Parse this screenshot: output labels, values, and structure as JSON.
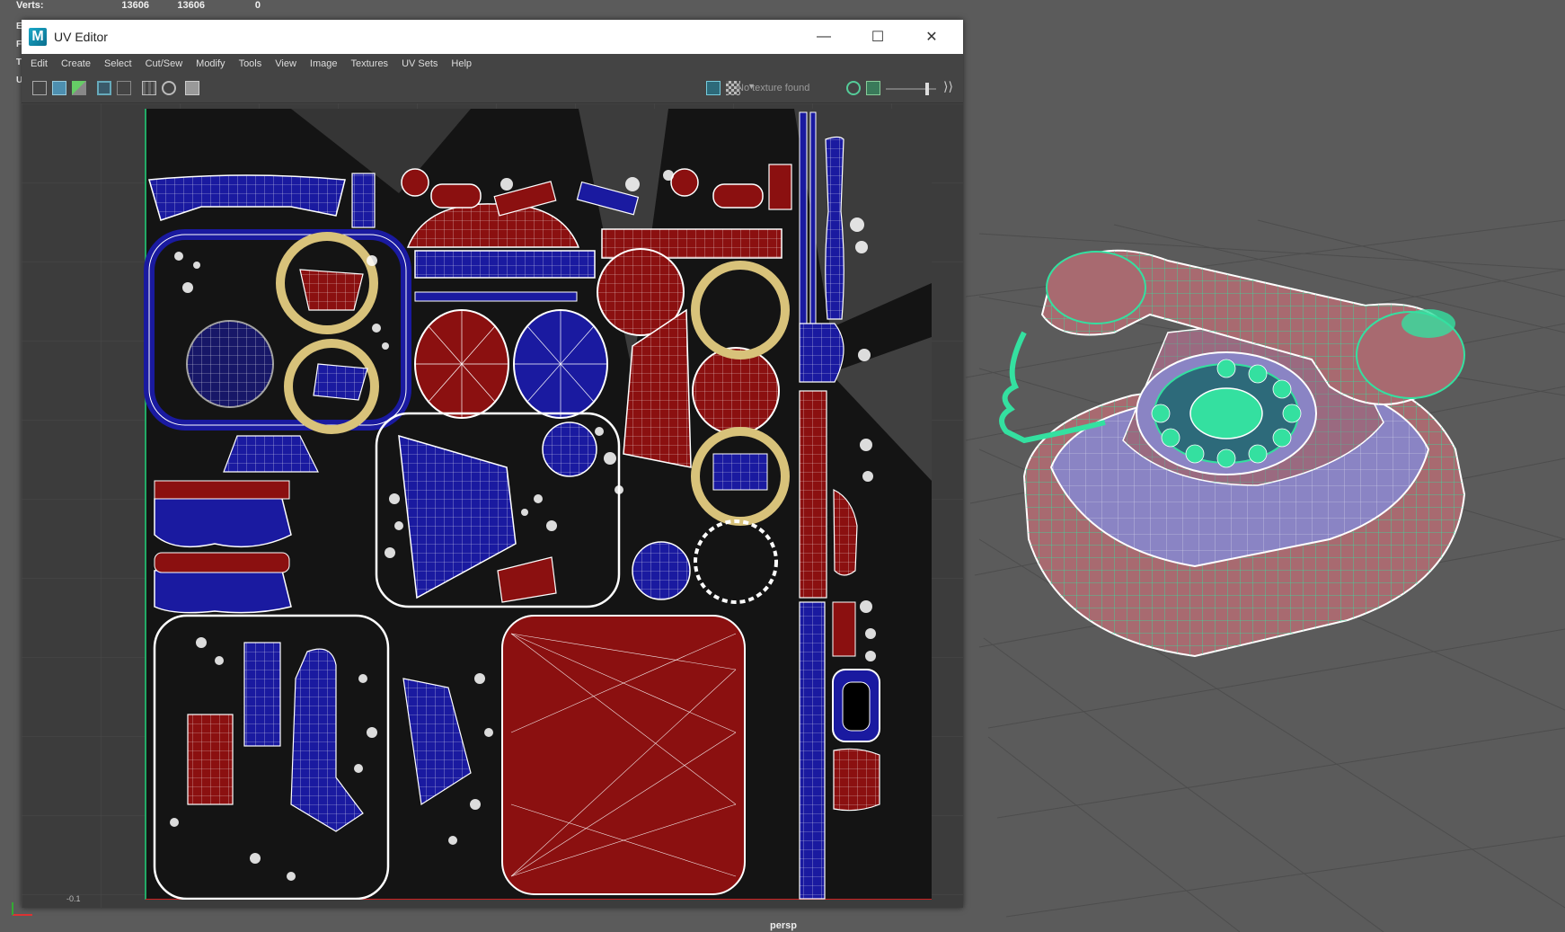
{
  "hud": {
    "verts_label": "Verts:",
    "verts_a": "13606",
    "verts_b": "13606",
    "verts_c": "0",
    "side_letters": [
      "E",
      "F",
      "T",
      "U"
    ]
  },
  "window": {
    "title": "UV Editor",
    "app_icon_letter": "M",
    "minimize": "—",
    "maximize": "☐",
    "close": "✕"
  },
  "menu": [
    "Edit",
    "Create",
    "Select",
    "Cut/Sew",
    "Modify",
    "Tools",
    "View",
    "Image",
    "Textures",
    "UV Sets",
    "Help"
  ],
  "toolbar": {
    "texture_status": "No texture found",
    "slider_value": 0.75
  },
  "uv_canvas": {
    "coord_label": "-0.1",
    "colors": {
      "red": "#8b1010",
      "blue": "#1a1aa0",
      "yellow": "#d8c27a",
      "background": "#141414"
    }
  },
  "viewport": {
    "camera_label": "persp",
    "wire_color": "#34e0a0",
    "shade_red": "#a86a70",
    "shade_blue": "#8a84c4"
  }
}
